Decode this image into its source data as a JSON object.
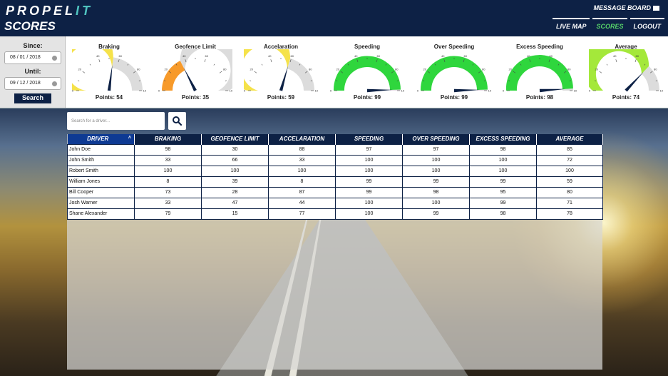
{
  "header": {
    "logo_main": "PROPEL",
    "logo_accent": "IT",
    "page_title": "SCORES",
    "message_board": "MESSAGE BOARD",
    "nav": [
      "LIVE MAP",
      "SCORES",
      "LOGOUT"
    ],
    "active_nav": "SCORES"
  },
  "filters": {
    "since_label": "Since:",
    "since_value": "08 / 01 / 2018",
    "until_label": "Until:",
    "until_value": "09 / 12 / 2018",
    "search_label": "Search"
  },
  "gauges": [
    {
      "title": "Braking",
      "points_text": "Points: 54",
      "value": 54,
      "color": "#f5e24a"
    },
    {
      "title": "Geofence Limit",
      "points_text": "Points: 35",
      "value": 35,
      "color": "#f79a2a"
    },
    {
      "title": "Accelaration",
      "points_text": "Points: 59",
      "value": 59,
      "color": "#f5e24a"
    },
    {
      "title": "Speeding",
      "points_text": "Points: 99",
      "value": 99,
      "color": "#2fd63d"
    },
    {
      "title": "Over Speeding",
      "points_text": "Points: 99",
      "value": 99,
      "color": "#2fd63d"
    },
    {
      "title": "Excess Speeding",
      "points_text": "Points: 98",
      "value": 98,
      "color": "#2fd63d"
    },
    {
      "title": "Average",
      "points_text": "Points: 74",
      "value": 74,
      "color": "#a4e83a"
    }
  ],
  "gauge_ticks": [
    "0",
    "20",
    "40",
    "60",
    "80",
    "100"
  ],
  "search": {
    "placeholder": "Search for a driver..."
  },
  "table": {
    "columns": [
      "DRIVER",
      "BRAKING",
      "GEOFENCE LIMIT",
      "ACCELARATION",
      "SPEEDING",
      "OVER SPEEDING",
      "EXCESS SPEEDING",
      "AVERAGE"
    ],
    "rows": [
      [
        "John Doe",
        "98",
        "30",
        "88",
        "97",
        "97",
        "98",
        "85"
      ],
      [
        "John Smith",
        "33",
        "66",
        "33",
        "100",
        "100",
        "100",
        "72"
      ],
      [
        "Robert Smith",
        "100",
        "100",
        "100",
        "100",
        "100",
        "100",
        "100"
      ],
      [
        "William Jones",
        "8",
        "39",
        "8",
        "99",
        "99",
        "99",
        "59"
      ],
      [
        "Bill Cooper",
        "73",
        "28",
        "87",
        "99",
        "98",
        "95",
        "80"
      ],
      [
        "Josh Warner",
        "33",
        "47",
        "44",
        "100",
        "100",
        "99",
        "71"
      ],
      [
        "Shane Alexander",
        "79",
        "15",
        "77",
        "100",
        "99",
        "98",
        "78"
      ]
    ]
  },
  "colors": {
    "navy": "#0d2145",
    "active_nav": "#57d46a",
    "driver_header": "#0e3a93"
  }
}
